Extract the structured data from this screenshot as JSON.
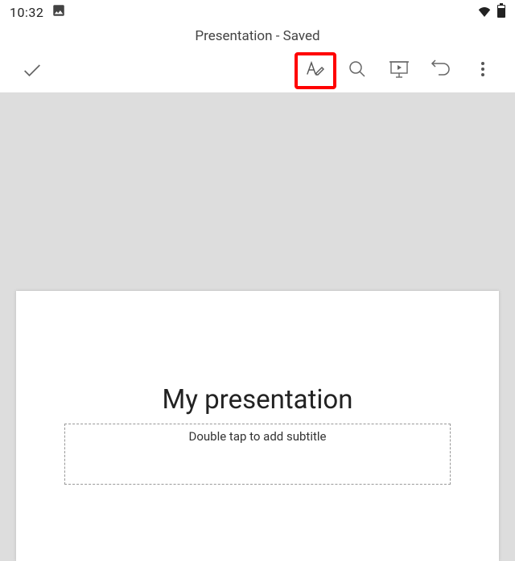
{
  "status": {
    "time": "10:32"
  },
  "header": {
    "title": "Presentation - Saved"
  },
  "slide": {
    "title_text": "My presentation",
    "subtitle_placeholder": "Double tap to add subtitle"
  }
}
